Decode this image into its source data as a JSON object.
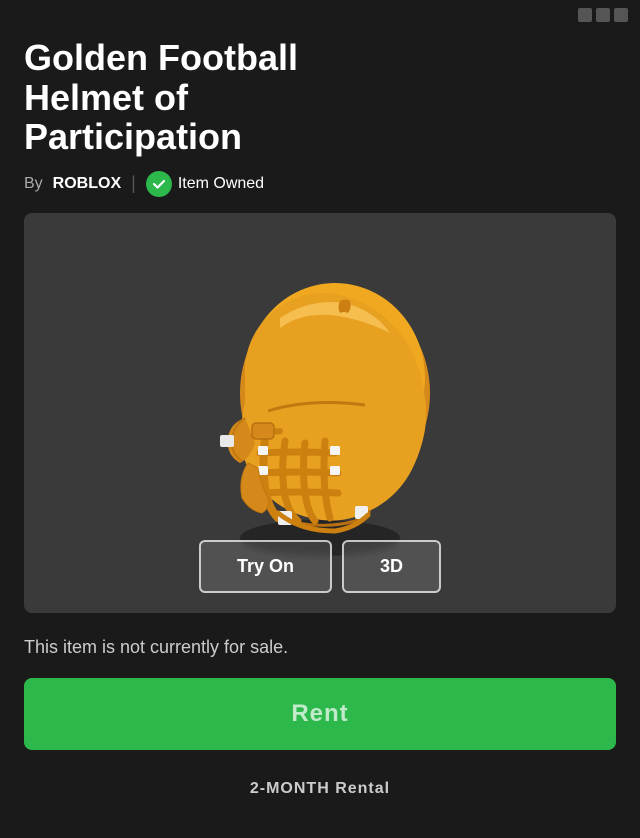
{
  "topbar": {
    "dots": [
      "dot1",
      "dot2",
      "dot3"
    ]
  },
  "header": {
    "title_line1": "Golden Football",
    "title_line2": "Helmet of",
    "title_line3": "Participation",
    "by_label": "By",
    "creator": "ROBLOX",
    "divider": "|",
    "owned_text": "Item Owned"
  },
  "preview": {
    "try_on_label": "Try On",
    "view_3d_label": "3D"
  },
  "purchase": {
    "sale_text": "This item is not currently for sale.",
    "rent_label": "Rent",
    "rental_period": "2-MONTH Rental"
  },
  "colors": {
    "background": "#1a1a1a",
    "preview_bg": "#3a3a3a",
    "green": "#2db84b",
    "helmet_gold": "#E8A020",
    "helmet_dark": "#B87010"
  }
}
